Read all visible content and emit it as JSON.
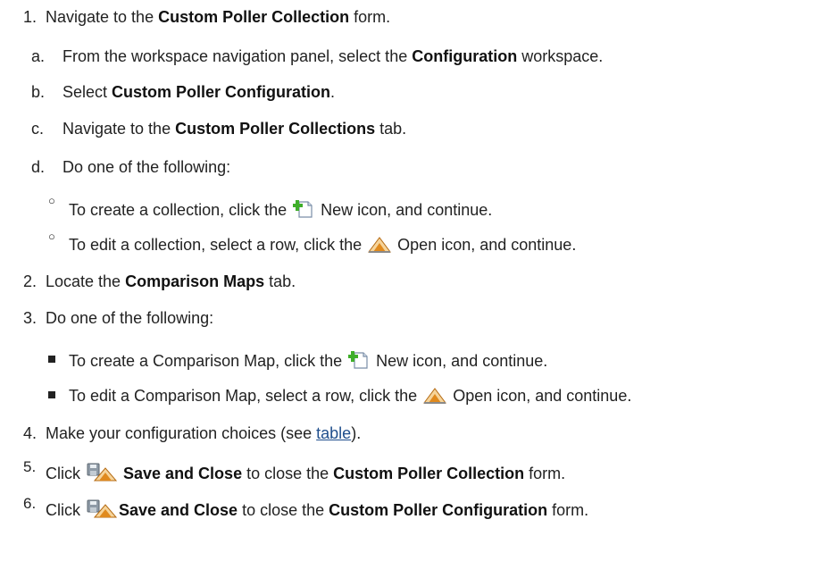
{
  "steps": {
    "s1": {
      "num": "1.",
      "pre": "Navigate to the ",
      "b1": "Custom Poller Collection",
      "post": " form."
    },
    "s1a": {
      "num": "a.",
      "pre": "From the workspace navigation panel, select the ",
      "b1": "Configuration",
      "post": " workspace."
    },
    "s1b": {
      "num": "b.",
      "pre": "Select ",
      "b1": "Custom Poller Configuration",
      "post": "."
    },
    "s1c": {
      "num": "c.",
      "pre": "Navigate to the ",
      "b1": "Custom Poller Collections",
      "post": " tab."
    },
    "s1d": {
      "num": "d.",
      "text": "Do one of the following:"
    },
    "s1d1": {
      "pre": "To create a collection, click the ",
      "post": " New icon, and continue."
    },
    "s1d2": {
      "pre": "To edit a collection, select a row, click the ",
      "post": " Open icon, and continue."
    },
    "s2": {
      "num": "2.",
      "pre": "Locate the ",
      "b1": "Comparison Maps",
      "post": " tab."
    },
    "s3": {
      "num": "3.",
      "text": "Do one of the following:"
    },
    "s3a": {
      "pre": "To create a Comparison Map, click the ",
      "post": " New icon, and continue."
    },
    "s3b": {
      "pre": "To edit a Comparison Map, select a row, click the ",
      "post": " Open icon, and continue."
    },
    "s4": {
      "num": "4.",
      "pre": "Make your configuration choices (see ",
      "link": "table",
      "post": ")."
    },
    "s5": {
      "num": "5.",
      "pre": "Click ",
      "b1": "Save and Close",
      "mid": " to close the ",
      "b2": "Custom Poller Collection",
      "post": " form."
    },
    "s6": {
      "num": "6.",
      "pre": "Click ",
      "b1": "Save and Close",
      "mid": " to close the ",
      "b2": "Custom Poller Configuration",
      "post": " form."
    }
  },
  "icons": {
    "new": "new-icon",
    "open": "open-icon",
    "save": "save-and-close-icon"
  },
  "colors": {
    "text": "#222222",
    "link": "#1f4e8c",
    "new_icon_plus": "#3fae2a",
    "open_icon_warning": "#e08a1e"
  }
}
